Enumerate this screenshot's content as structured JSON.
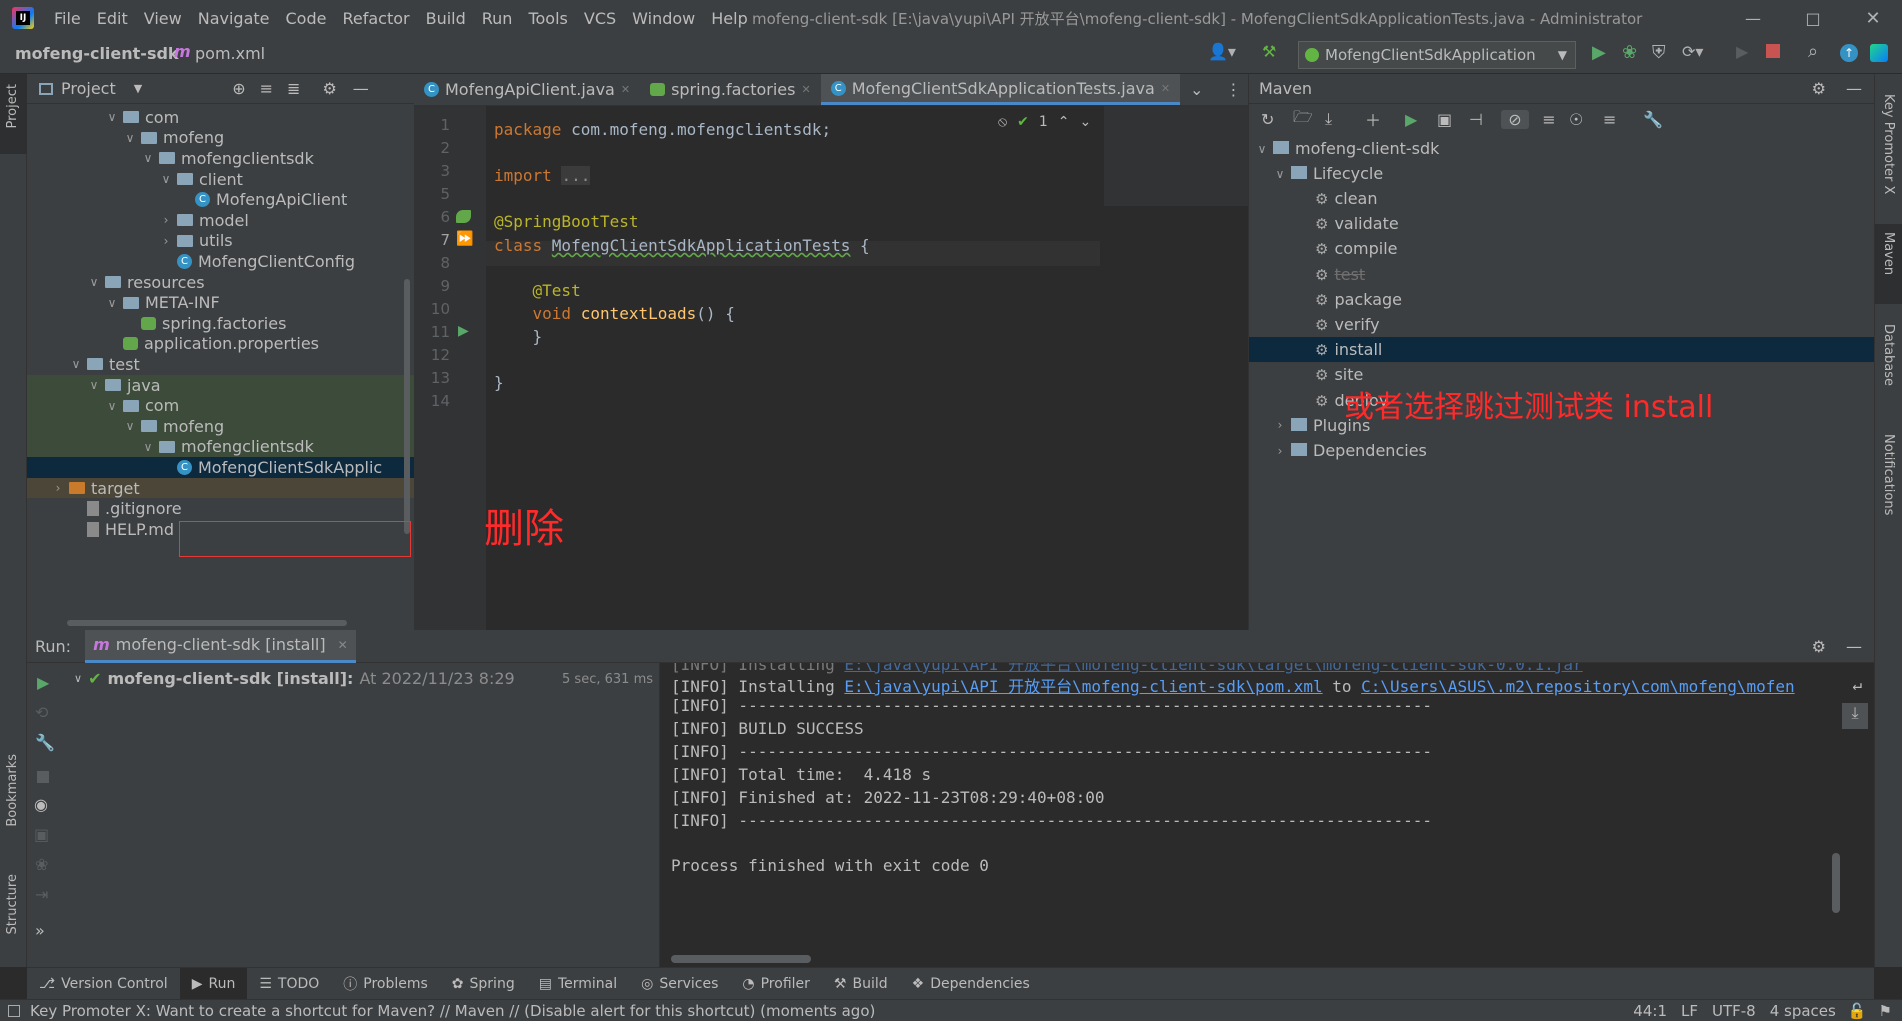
{
  "window": {
    "title": "mofeng-client-sdk [E:\\java\\yupi\\API 开放平台\\mofeng-client-sdk] - MofengClientSdkApplicationTests.java - Administrator",
    "menu": [
      "File",
      "Edit",
      "View",
      "Navigate",
      "Code",
      "Refactor",
      "Build",
      "Run",
      "Tools",
      "VCS",
      "Window",
      "Help"
    ]
  },
  "nav": {
    "project": "mofeng-client-sdk",
    "file": "pom.xml",
    "run_config": "MofengClientSdkApplication"
  },
  "project_panel": {
    "title": "Project",
    "rows": [
      {
        "label": "com",
        "type": "folder",
        "depth": 4,
        "open": true
      },
      {
        "label": "mofeng",
        "type": "folder",
        "depth": 5,
        "open": true
      },
      {
        "label": "mofengclientsdk",
        "type": "folder",
        "depth": 6,
        "open": true
      },
      {
        "label": "client",
        "type": "folder",
        "depth": 7,
        "open": true
      },
      {
        "label": "MofengApiClient",
        "type": "class",
        "depth": 8
      },
      {
        "label": "model",
        "type": "folder",
        "depth": 7,
        "open": false
      },
      {
        "label": "utils",
        "type": "folder",
        "depth": 7,
        "open": false
      },
      {
        "label": "MofengClientConfig",
        "type": "class",
        "depth": 7
      },
      {
        "label": "resources",
        "type": "folder",
        "depth": 3,
        "open": true
      },
      {
        "label": "META-INF",
        "type": "folder",
        "depth": 4,
        "open": true
      },
      {
        "label": "spring.factories",
        "type": "leaf",
        "depth": 5
      },
      {
        "label": "application.properties",
        "type": "leaf",
        "depth": 4
      },
      {
        "label": "test",
        "type": "folder",
        "depth": 2,
        "open": true
      },
      {
        "label": "java",
        "type": "folder",
        "depth": 3,
        "open": true,
        "hl": true
      },
      {
        "label": "com",
        "type": "folder",
        "depth": 4,
        "open": true,
        "hl": true
      },
      {
        "label": "mofeng",
        "type": "folder",
        "depth": 5,
        "open": true,
        "hl": true
      },
      {
        "label": "mofengclientsdk",
        "type": "folder",
        "depth": 6,
        "open": true,
        "hl": true
      },
      {
        "label": "MofengClientSdkApplic",
        "type": "class",
        "depth": 7,
        "sel": true
      },
      {
        "label": "target",
        "type": "target",
        "depth": 1,
        "open": false,
        "tg": true
      },
      {
        "label": ".gitignore",
        "type": "file",
        "depth": 2
      },
      {
        "label": "HELP.md",
        "type": "file",
        "depth": 2
      }
    ]
  },
  "annotations": {
    "delete": "删除",
    "skip_tests": "或者选择跳过测试类 install"
  },
  "editor": {
    "tabs": [
      {
        "label": "MofengApiClient.java",
        "active": false
      },
      {
        "label": "spring.factories",
        "active": false
      },
      {
        "label": "MofengClientSdkApplicationTests.java",
        "active": true
      }
    ],
    "inspection_count": "1",
    "lines": [
      {
        "n": "1",
        "text": "package com.mofeng.mofengclientsdk;"
      },
      {
        "n": "2",
        "text": ""
      },
      {
        "n": "3",
        "text": "import ..."
      },
      {
        "n": "5",
        "text": ""
      },
      {
        "n": "6",
        "text": "@SpringBootTest"
      },
      {
        "n": "7",
        "text": "class MofengClientSdkApplicationTests {"
      },
      {
        "n": "8",
        "text": ""
      },
      {
        "n": "9",
        "text": "    @Test"
      },
      {
        "n": "10",
        "text": "    void contextLoads() {"
      },
      {
        "n": "11",
        "text": "    }"
      },
      {
        "n": "12",
        "text": ""
      },
      {
        "n": "13",
        "text": "}"
      },
      {
        "n": "14",
        "text": ""
      }
    ]
  },
  "maven": {
    "title": "Maven",
    "root": "mofeng-client-sdk",
    "lifecycle": "Lifecycle",
    "goals": [
      "clean",
      "validate",
      "compile",
      "test",
      "package",
      "verify",
      "install",
      "site",
      "deploy"
    ],
    "selected_goal": "install",
    "plugins": "Plugins",
    "dependencies": "Dependencies"
  },
  "run": {
    "label": "Run:",
    "tab": "mofeng-client-sdk [install]",
    "task": "mofeng-client-sdk [install]:",
    "task_time": "At 2022/11/23 8:29",
    "duration": "5 sec, 631 ms",
    "console": [
      {
        "prefix": "[INFO] Installing ",
        "link": "E:\\java\\yupi\\API 开放平台\\mofeng-client-sdk\\pom.xml",
        "mid": " to ",
        "link2": "C:\\Users\\ASUS\\.m2\\repository\\com\\mofeng\\mofen"
      },
      {
        "prefix": "[INFO] ------------------------------------------------------------------------"
      },
      {
        "prefix": "[INFO] BUILD SUCCESS"
      },
      {
        "prefix": "[INFO] ------------------------------------------------------------------------"
      },
      {
        "prefix": "[INFO] Total time:  4.418 s"
      },
      {
        "prefix": "[INFO] Finished at: 2022-11-23T08:29:40+08:00"
      },
      {
        "prefix": "[INFO] ------------------------------------------------------------------------"
      },
      {
        "prefix": ""
      },
      {
        "prefix": "Process finished with exit code 0"
      }
    ]
  },
  "bottom_tabs": [
    "Version Control",
    "Run",
    "TODO",
    "Problems",
    "Spring",
    "Terminal",
    "Services",
    "Profiler",
    "Build",
    "Dependencies"
  ],
  "left_strip": [
    "Project",
    "Bookmarks",
    "Structure"
  ],
  "right_strip": [
    "Key Promoter X",
    "Maven",
    "Database",
    "Notifications"
  ],
  "status": {
    "message": "Key Promoter X: Want to create a shortcut for Maven? // Maven // (Disable alert for this shortcut) (moments ago)",
    "position": "44:1",
    "line_sep": "LF",
    "encoding": "UTF-8",
    "indent": "4 spaces"
  }
}
